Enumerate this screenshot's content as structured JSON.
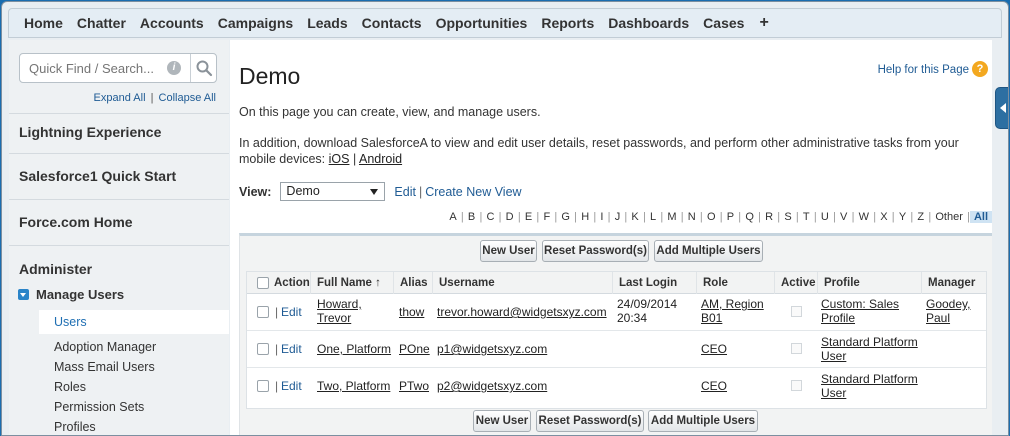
{
  "nav": {
    "tabs": [
      "Home",
      "Chatter",
      "Accounts",
      "Campaigns",
      "Leads",
      "Contacts",
      "Opportunities",
      "Reports",
      "Dashboards",
      "Cases"
    ],
    "plus_label": "+"
  },
  "sidebar": {
    "search_placeholder": "Quick Find / Search...",
    "expand_all": "Expand All",
    "separator": "|",
    "collapse_all": "Collapse All",
    "sections": [
      "Lightning Experience",
      "Salesforce1 Quick Start",
      "Force.com Home",
      "Administer"
    ],
    "manage_users": "Manage Users",
    "items": [
      "Users",
      "Adoption Manager",
      "Mass Email Users",
      "Roles",
      "Permission Sets",
      "Profiles"
    ],
    "active_item": "Users"
  },
  "main": {
    "title": "Demo",
    "help_link": "Help for this Page",
    "intro": "On this page you can create, view, and manage users.",
    "addition_text": "In addition, download SalesforceA to view and edit user details, reset passwords, and perform other administrative tasks from your mobile devices: ",
    "ios_link": "iOS",
    "link_sep": " | ",
    "android_link": "Android",
    "view_label": "View:",
    "view_value": "Demo",
    "edit_link": "Edit",
    "view_pipe": "|",
    "create_view_link": "Create New View",
    "alphabet": [
      "A",
      "B",
      "C",
      "D",
      "E",
      "F",
      "G",
      "H",
      "I",
      "J",
      "K",
      "L",
      "M",
      "N",
      "O",
      "P",
      "Q",
      "R",
      "S",
      "T",
      "U",
      "V",
      "W",
      "X",
      "Y",
      "Z",
      "Other",
      "All"
    ],
    "buttons": {
      "new_user": "New User",
      "reset_password": "Reset Password(s)",
      "add_multiple": "Add Multiple Users"
    },
    "columns": [
      "Action",
      "Full Name",
      "Alias",
      "Username",
      "Last Login",
      "Role",
      "Active",
      "Profile",
      "Manager"
    ],
    "sort_indicator": "↑",
    "rows": [
      {
        "action_sep": "|",
        "action": "Edit",
        "full_name_1": "Howard,",
        "full_name_2": "Trevor",
        "alias": "thow",
        "username": "trevor.howard@widgetsxyz.com",
        "last_login_1": "24/09/2014",
        "last_login_2": "20:34",
        "role_1": "AM, Region",
        "role_2": "B01",
        "profile_1": "Custom: Sales",
        "profile_2": "Profile",
        "manager_1": "Goodey,",
        "manager_2": "Paul"
      },
      {
        "action_sep": "|",
        "action": "Edit",
        "full_name_1": "One, Platform",
        "full_name_2": "",
        "alias": "POne",
        "username": "p1@widgetsxyz.com",
        "last_login_1": "",
        "last_login_2": "",
        "role_1": "CEO",
        "role_2": "",
        "profile_1": "Standard Platform",
        "profile_2": "User",
        "manager_1": "",
        "manager_2": ""
      },
      {
        "action_sep": "|",
        "action": "Edit",
        "full_name_1": "Two, Platform",
        "full_name_2": "",
        "alias": "PTwo",
        "username": "p2@widgetsxyz.com",
        "last_login_1": "",
        "last_login_2": "",
        "role_1": "CEO",
        "role_2": "",
        "profile_1": "Standard Platform",
        "profile_2": "User",
        "manager_1": "",
        "manager_2": ""
      }
    ]
  },
  "colors": {
    "link": "#1f5b94",
    "accent": "#2a84c8",
    "help_icon": "#f3a820"
  }
}
